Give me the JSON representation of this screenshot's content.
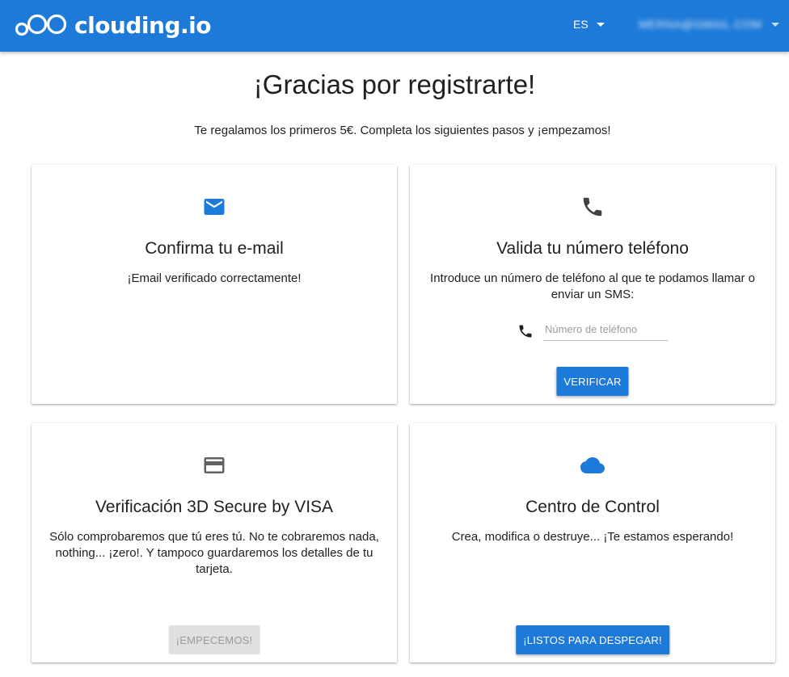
{
  "header": {
    "logo_text": "clouding.io",
    "language": "ES",
    "user_label": "MERNA@GMAIL.COM",
    "brand_color": "#1e7ad8"
  },
  "main": {
    "title": "¡Gracias por registrarte!",
    "subtitle": "Te regalamos los primeros 5€. Completa los siguientes pasos y ¡empezamos!"
  },
  "cards": [
    {
      "icon": "mail-icon",
      "title": "Confirma tu e-mail",
      "text": "¡Email verificado correctamente!"
    },
    {
      "icon": "phone-icon",
      "title": "Valida tu número teléfono",
      "text": "Introduce un número de teléfono al que te podamos llamar o enviar un SMS:",
      "input_placeholder": "Número de teléfono",
      "button": "VERIFICAR"
    },
    {
      "icon": "credit-card-icon",
      "title": "Verificación 3D Secure by VISA",
      "text": "Sólo comprobaremos que tú eres tú. No te cobraremos nada, nothing... ¡zero!. Y tampoco guardaremos los detalles de tu tarjeta.",
      "button": "¡EMPECEMOS!",
      "button_disabled": true
    },
    {
      "icon": "cloud-icon",
      "title": "Centro de Control",
      "text": "Crea, modifica o destruye... ¡Te estamos esperando!",
      "button": "¡LISTOS PARA DESPEGAR!"
    }
  ]
}
